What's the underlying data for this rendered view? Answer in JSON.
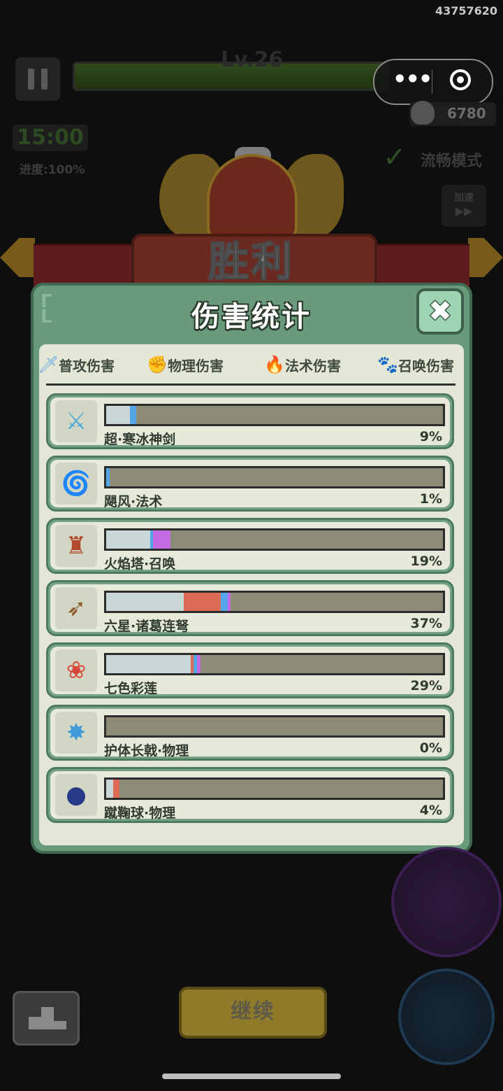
{
  "session_id": "43757620",
  "hud": {
    "level": "Lv.26",
    "kills": "6780",
    "timer": "15:00",
    "progress": "进度:100%",
    "smooth_mode": "流畅模式",
    "speed_up": "加速",
    "speed_icon": "▶▶"
  },
  "miniprogram": {
    "more": "•••"
  },
  "victory": "胜利",
  "panel": {
    "title": "伤害统计",
    "close_glyph": "✖",
    "legend": [
      {
        "icon": "sword-icon",
        "glyph": "🗡",
        "color": "#6aaee8",
        "label": "普攻伤害"
      },
      {
        "icon": "fist-icon",
        "glyph": "✊",
        "color": "#d85550",
        "label": "物理伤害"
      },
      {
        "icon": "flame-icon",
        "glyph": "🔥",
        "color": "#3f7de0",
        "label": "法术伤害"
      },
      {
        "icon": "paw-icon",
        "glyph": "🐾",
        "color": "#c36ae0",
        "label": "召唤伤害"
      }
    ],
    "segment_colors": {
      "base": "#c9d7d7",
      "attack": "#55a6e8",
      "physical": "#db6a57",
      "magic": "#5b8fe8",
      "summon": "#c36ae0"
    },
    "rows": [
      {
        "name": "超·寒冰神剑",
        "percent": "9%",
        "icon": "ice-sword-icon",
        "glyph": "⚔",
        "glyph_color": "#4aa7d8",
        "segments": [
          {
            "type": "base",
            "value": 7
          },
          {
            "type": "attack",
            "value": 2
          }
        ]
      },
      {
        "name": "飓风·法术",
        "percent": "1%",
        "icon": "tornado-icon",
        "glyph": "🌀",
        "glyph_color": "#4aa35c",
        "segments": [
          {
            "type": "attack",
            "value": 1
          }
        ]
      },
      {
        "name": "火焰塔·召唤",
        "percent": "19%",
        "icon": "fire-tower-icon",
        "glyph": "♜",
        "glyph_color": "#b04a2a",
        "segments": [
          {
            "type": "base",
            "value": 13
          },
          {
            "type": "attack",
            "value": 1
          },
          {
            "type": "summon",
            "value": 5
          }
        ]
      },
      {
        "name": "六星·诸葛连弩",
        "percent": "37%",
        "icon": "crossbow-icon",
        "glyph": "➶",
        "glyph_color": "#8a5a2a",
        "segments": [
          {
            "type": "base",
            "value": 23
          },
          {
            "type": "physical",
            "value": 11
          },
          {
            "type": "attack",
            "value": 2
          },
          {
            "type": "summon",
            "value": 1
          }
        ]
      },
      {
        "name": "七色彩莲",
        "percent": "29%",
        "icon": "lotus-icon",
        "glyph": "❀",
        "glyph_color": "#d8483a",
        "segments": [
          {
            "type": "base",
            "value": 25
          },
          {
            "type": "physical",
            "value": 1
          },
          {
            "type": "attack",
            "value": 1
          },
          {
            "type": "summon",
            "value": 1
          }
        ]
      },
      {
        "name": "护体长戟·物理",
        "percent": "0%",
        "icon": "halberd-icon",
        "glyph": "✸",
        "glyph_color": "#3f9ad8",
        "segments": []
      },
      {
        "name": "蹴鞠球·物理",
        "percent": "4%",
        "icon": "ball-icon",
        "glyph": "●",
        "glyph_color": "#2a3a8a",
        "segments": [
          {
            "type": "base",
            "value": 2
          },
          {
            "type": "physical",
            "value": 2
          }
        ]
      }
    ]
  },
  "bottom": {
    "continue": "继续"
  }
}
